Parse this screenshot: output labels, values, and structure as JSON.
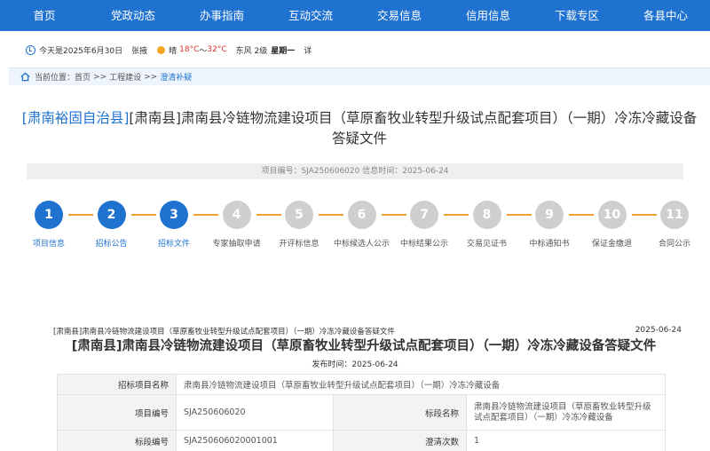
{
  "nav": {
    "items": [
      "首页",
      "党政动态",
      "办事指南",
      "互动交流",
      "交易信息",
      "信用信息",
      "下载专区",
      "各县中心"
    ]
  },
  "info": {
    "date_text": "今天是2025年6月30日",
    "location": "张掖",
    "weather": "晴",
    "temp_low": "18°C",
    "temp_sep": "～",
    "temp_high": "32°C",
    "wind": "东风 2级",
    "weekday": "星期一",
    "detail": "详"
  },
  "breadcrumb": {
    "prefix": "当前位置：",
    "home": "首页",
    "sep": ">>",
    "category": "工程建设",
    "current": "澄清补疑"
  },
  "page": {
    "region_tag": "[肃南裕固自治县]",
    "title": "[肃南县]肃南县冷链物流建设项目（草原畜牧业转型升级试点配套项目）（一期）冷冻冷藏设备答疑文件",
    "meta": "项目编号：SJA250606020  信息时间：2025-06-24"
  },
  "steps": [
    {
      "num": "1",
      "label": "项目信息",
      "active": true
    },
    {
      "num": "2",
      "label": "招标公告",
      "active": true
    },
    {
      "num": "3",
      "label": "招标文件",
      "active": true
    },
    {
      "num": "4",
      "label": "专家抽取申请",
      "active": false
    },
    {
      "num": "5",
      "label": "开评标信息",
      "active": false
    },
    {
      "num": "6",
      "label": "中标候选人公示",
      "active": false
    },
    {
      "num": "7",
      "label": "中标结果公示",
      "active": false
    },
    {
      "num": "8",
      "label": "交易见证书",
      "active": false
    },
    {
      "num": "9",
      "label": "中标通知书",
      "active": false
    },
    {
      "num": "10",
      "label": "保证金缴退",
      "active": false
    },
    {
      "num": "11",
      "label": "合同公示",
      "active": false
    }
  ],
  "doc": {
    "small_title": "[肃南县]肃南县冷链物流建设项目（草原畜牧业转型升级试点配套项目）（一期）冷冻冷藏设备答疑文件",
    "date": "2025-06-24",
    "title": "[肃南县]肃南县冷链物流建设项目（草原畜牧业转型升级试点配套项目）（一期）冷冻冷藏设备答疑文件",
    "published": "发布时间：2025-06-24"
  },
  "table": {
    "project_name_label": "招标项目名称",
    "project_name": "肃南县冷链物流建设项目（草原畜牧业转型升级试点配套项目）（一期）冷冻冷藏设备",
    "project_no_label": "项目编号",
    "project_no": "SJA250606020",
    "section_name_label": "标段名称",
    "section_name": "肃南县冷链物流建设项目（草原畜牧业转型升级试点配套项目）（一期）冷冻冷藏设备",
    "section_no_label": "标段编号",
    "section_no": "SJA250606020001001",
    "clarify_count_label": "澄清次数",
    "clarify_count": "1"
  },
  "colors": {
    "brand": "#1f72cf",
    "step_connector": "#f0a030",
    "step_inactive": "#cfcfcf",
    "temp_text": "#e0332d"
  }
}
